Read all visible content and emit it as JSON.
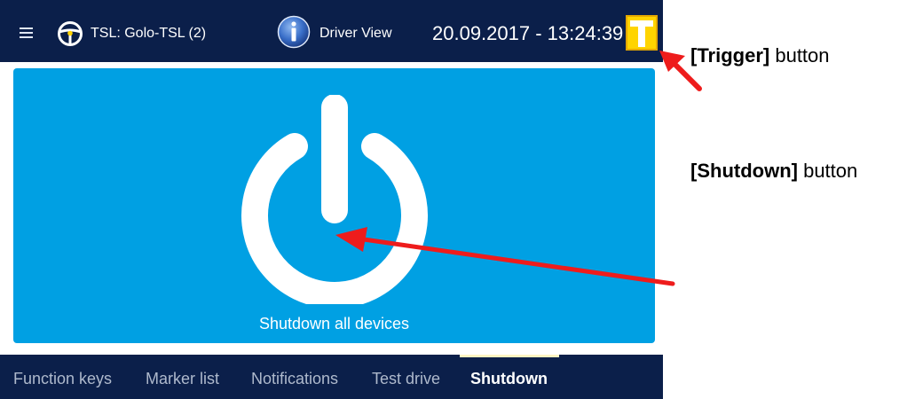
{
  "header": {
    "tsl_label": "TSL: Golo-TSL (2)",
    "view_label": "Driver View",
    "datetime": "20.09.2017 - 13:24:39",
    "trigger_letter": "T"
  },
  "main": {
    "shutdown_label": "Shutdown all devices"
  },
  "tabs": [
    {
      "label": "Function keys",
      "active": false
    },
    {
      "label": "Marker list",
      "active": false
    },
    {
      "label": "Notifications",
      "active": false
    },
    {
      "label": "Test drive",
      "active": false
    },
    {
      "label": "Shutdown",
      "active": true
    }
  ],
  "annotations": {
    "trigger_bold": "[Trigger]",
    "trigger_rest": " button",
    "shutdown_bold": "[Shutdown]",
    "shutdown_rest": " button"
  },
  "colors": {
    "header_bg": "#0b1f4a",
    "panel_bg": "#00a0e3",
    "trigger_yellow": "#ffd400",
    "arrow_red": "#ee1c1c"
  },
  "icons": [
    "menu-icon",
    "steering-wheel-icon",
    "info-icon",
    "trigger-t-icon",
    "power-icon"
  ]
}
